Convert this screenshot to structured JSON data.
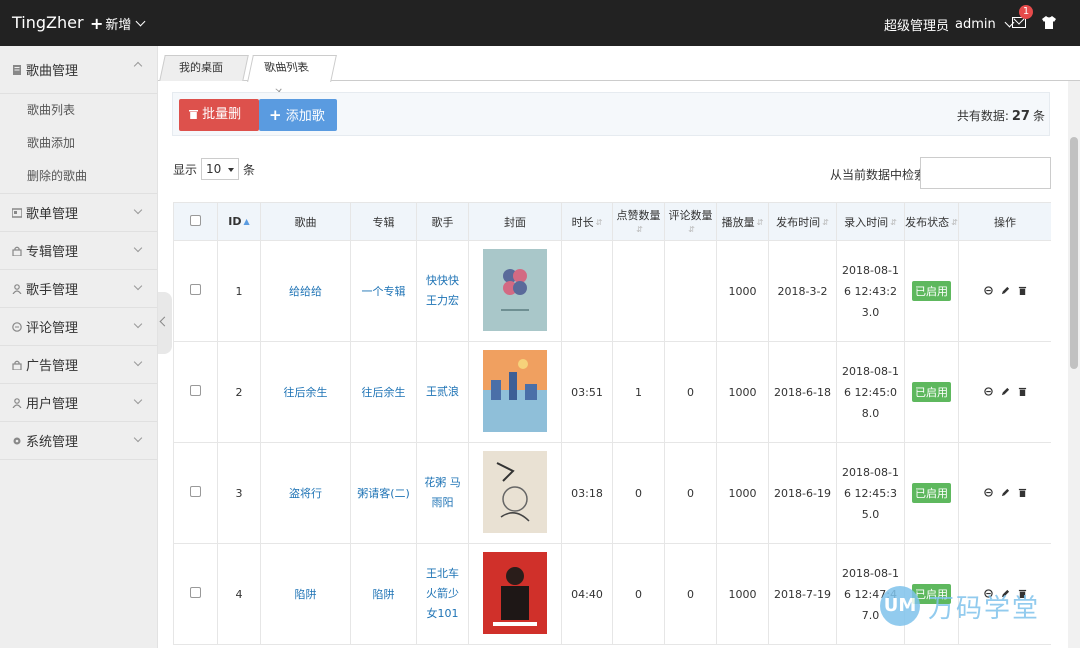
{
  "header": {
    "logo": "TingZher",
    "add_label": "新增",
    "role": "超级管理员",
    "username": "admin",
    "notification_count": "1"
  },
  "sidebar": {
    "groups": [
      {
        "label": "歌曲管理",
        "icon": "document-icon",
        "expanded": true,
        "items": [
          "歌曲列表",
          "歌曲添加",
          "删除的歌曲"
        ]
      },
      {
        "label": "歌单管理",
        "icon": "playlist-icon"
      },
      {
        "label": "专辑管理",
        "icon": "lock-icon"
      },
      {
        "label": "歌手管理",
        "icon": "user-icon"
      },
      {
        "label": "评论管理",
        "icon": "comment-icon"
      },
      {
        "label": "广告管理",
        "icon": "lock-icon"
      },
      {
        "label": "用户管理",
        "icon": "user-icon"
      },
      {
        "label": "系统管理",
        "icon": "gear-icon"
      }
    ]
  },
  "tabs": [
    {
      "label": "我的桌面"
    },
    {
      "label": "歌曲列表",
      "close": "×"
    }
  ],
  "toolbar": {
    "batch_delete": "批量删除",
    "add_song": "添加歌曲",
    "total_prefix": "共有数据:",
    "total_count": "27",
    "total_suffix": "条"
  },
  "list_controls": {
    "show_label": "显示",
    "page_size": "10",
    "unit": "条",
    "search_label": "从当前数据中检索:"
  },
  "table": {
    "headers": [
      "ID",
      "歌曲",
      "专辑",
      "歌手",
      "封面",
      "时长",
      "点赞数量",
      "评论数量",
      "播放量",
      "发布时间",
      "录入时间",
      "发布状态",
      "操作"
    ],
    "rows": [
      {
        "id": "1",
        "song": "给给给",
        "album": "一个专辑",
        "singer": "快快快 王力宏",
        "duration": "",
        "likes": "",
        "comments": "",
        "plays": "1000",
        "release": "2018-3-2",
        "entered": "2018-08-16 12:43:23.0",
        "status": "已启用"
      },
      {
        "id": "2",
        "song": "往后余生",
        "album": "往后余生",
        "singer": "王贰浪",
        "duration": "03:51",
        "likes": "1",
        "comments": "0",
        "plays": "1000",
        "release": "2018-6-18",
        "entered": "2018-08-16 12:45:08.0",
        "status": "已启用"
      },
      {
        "id": "3",
        "song": "盗将行",
        "album": "粥请客(二)",
        "singer": "花粥 马雨阳",
        "duration": "03:18",
        "likes": "0",
        "comments": "0",
        "plays": "1000",
        "release": "2018-6-19",
        "entered": "2018-08-16 12:45:35.0",
        "status": "已启用"
      },
      {
        "id": "4",
        "song": "陷阱",
        "album": "陷阱",
        "singer": "王北车 火箭少女101",
        "duration": "04:40",
        "likes": "0",
        "comments": "0",
        "plays": "1000",
        "release": "2018-7-19",
        "entered": "2018-08-16 12:47:47.0",
        "status": "已启用"
      }
    ]
  },
  "watermark": {
    "logo": "UM",
    "text": "万码学堂"
  },
  "colors": {
    "header_bg": "#222222",
    "danger": "#dd514c",
    "primary": "#5a9be0",
    "success": "#5eb85e",
    "link": "#1e73b5"
  }
}
